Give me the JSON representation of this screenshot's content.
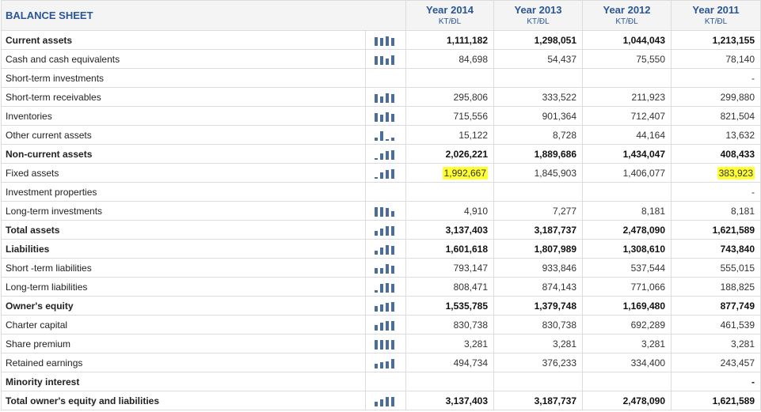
{
  "title": "BALANCE SHEET",
  "years": [
    {
      "label": "Year 2014",
      "unit": "KT/ĐL"
    },
    {
      "label": "Year 2013",
      "unit": "KT/ĐL"
    },
    {
      "label": "Year 2012",
      "unit": "KT/ĐL"
    },
    {
      "label": "Year 2011",
      "unit": "KT/ĐL"
    }
  ],
  "rows": [
    {
      "label": "Current assets",
      "bold": true,
      "values": [
        "1,111,182",
        "1,298,051",
        "1,044,043",
        "1,213,155"
      ],
      "chart": true
    },
    {
      "label": "Cash and cash equivalents",
      "bold": false,
      "values": [
        "84,698",
        "54,437",
        "75,550",
        "78,140"
      ],
      "chart": true
    },
    {
      "label": "Short-term investments",
      "bold": false,
      "values": [
        "",
        "",
        "",
        "-"
      ],
      "chart": false
    },
    {
      "label": "Short-term receivables",
      "bold": false,
      "values": [
        "295,806",
        "333,522",
        "211,923",
        "299,880"
      ],
      "chart": true
    },
    {
      "label": "Inventories",
      "bold": false,
      "values": [
        "715,556",
        "901,364",
        "712,407",
        "821,504"
      ],
      "chart": true
    },
    {
      "label": "Other current assets",
      "bold": false,
      "values": [
        "15,122",
        "8,728",
        "44,164",
        "13,632"
      ],
      "chart": true
    },
    {
      "label": "Non-current assets",
      "bold": true,
      "values": [
        "2,026,221",
        "1,889,686",
        "1,434,047",
        "408,433"
      ],
      "chart": true
    },
    {
      "label": "Fixed assets",
      "bold": false,
      "values": [
        "1,992,667",
        "1,845,903",
        "1,406,077",
        "383,923"
      ],
      "chart": true,
      "highlight": [
        0,
        3
      ]
    },
    {
      "label": "Investment properties",
      "bold": false,
      "values": [
        "",
        "",
        "",
        "-"
      ],
      "chart": false
    },
    {
      "label": "Long-term investments",
      "bold": false,
      "values": [
        "4,910",
        "7,277",
        "8,181",
        "8,181"
      ],
      "chart": true
    },
    {
      "label": "Total assets",
      "bold": true,
      "values": [
        "3,137,403",
        "3,187,737",
        "2,478,090",
        "1,621,589"
      ],
      "chart": true
    },
    {
      "label": "Liabilities",
      "bold": true,
      "values": [
        "1,601,618",
        "1,807,989",
        "1,308,610",
        "743,840"
      ],
      "chart": true
    },
    {
      "label": "Short -term liabilities",
      "bold": false,
      "values": [
        "793,147",
        "933,846",
        "537,544",
        "555,015"
      ],
      "chart": true
    },
    {
      "label": "Long-term liabilities",
      "bold": false,
      "values": [
        "808,471",
        "874,143",
        "771,066",
        "188,825"
      ],
      "chart": true
    },
    {
      "label": "Owner's equity",
      "bold": true,
      "values": [
        "1,535,785",
        "1,379,748",
        "1,169,480",
        "877,749"
      ],
      "chart": true
    },
    {
      "label": "Charter capital",
      "bold": false,
      "values": [
        "830,738",
        "830,738",
        "692,289",
        "461,539"
      ],
      "chart": true
    },
    {
      "label": "Share premium",
      "bold": false,
      "values": [
        "3,281",
        "3,281",
        "3,281",
        "3,281"
      ],
      "chart": true
    },
    {
      "label": "Retained earnings",
      "bold": false,
      "values": [
        "494,734",
        "376,233",
        "334,400",
        "243,457"
      ],
      "chart": true
    },
    {
      "label": "Minority interest",
      "bold": true,
      "values": [
        "",
        "",
        "",
        "-"
      ],
      "chart": false
    },
    {
      "label": "Total owner's equity and liabilities",
      "bold": true,
      "values": [
        "3,137,403",
        "3,187,737",
        "2,478,090",
        "1,621,589"
      ],
      "chart": true
    }
  ],
  "colors": {
    "header_text": "#2b5597",
    "bar": "#4a6d99",
    "highlight": "#ffff33"
  },
  "icons": {
    "trend": "mini-bar-chart-icon"
  }
}
